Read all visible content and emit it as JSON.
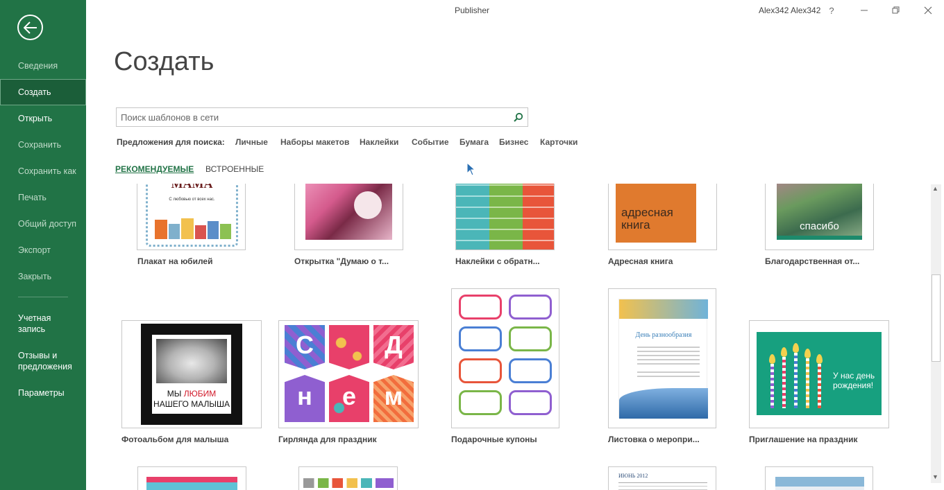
{
  "app": {
    "title": "Publisher",
    "user": "Alex342 Alex342"
  },
  "window_controls": {
    "help": "?",
    "minimize": "—",
    "restore": "❐",
    "close": "✕"
  },
  "sidebar": {
    "items": [
      {
        "label": "Сведения"
      },
      {
        "label": "Создать"
      },
      {
        "label": "Открыть"
      },
      {
        "label": "Сохранить"
      },
      {
        "label": "Сохранить как"
      },
      {
        "label": "Печать"
      },
      {
        "label": "Общий доступ"
      },
      {
        "label": "Экспорт"
      },
      {
        "label": "Закрыть"
      },
      {
        "label": "Учетная запись"
      },
      {
        "label": "Отзывы и предложения"
      },
      {
        "label": "Параметры"
      }
    ]
  },
  "main": {
    "title": "Создать",
    "search": {
      "placeholder": "Поиск шаблонов в сети",
      "value": ""
    },
    "suggestions_label": "Предложения для поиска:",
    "suggestions": [
      "Личные",
      "Наборы макетов",
      "Наклейки",
      "Событие",
      "Бумага",
      "Бизнес",
      "Карточки"
    ],
    "tabs": [
      {
        "label": "РЕКОМЕНДУЕМЫЕ"
      },
      {
        "label": "ВСТРОЕННЫЕ"
      }
    ],
    "templates": [
      {
        "label": "Плакат на юбилей",
        "text1": "МАМА",
        "text2": "С любовью от всех нас."
      },
      {
        "label": "Открытка \"Думаю о т..."
      },
      {
        "label": "Наклейки с обратн..."
      },
      {
        "label": "Адресная книга",
        "text1": "адресная книга"
      },
      {
        "label": "Благодарственная от...",
        "text1": "спасибо"
      },
      {
        "label": "Фотоальбом для малыша",
        "text1": "МЫ",
        "text2": "ЛЮБИМ",
        "text3": "НАШЕГО МАЛЫША"
      },
      {
        "label": "Гирлянда для праздник",
        "letters": [
          "С",
          "Д",
          "н",
          "е",
          "м"
        ]
      },
      {
        "label": "Подарочные купоны"
      },
      {
        "label": "Листовка о меропри...",
        "text1": "День разнообразия"
      },
      {
        "label": "Приглашение на праздник",
        "text1": "У нас день рождения!"
      }
    ],
    "partial_calendar": {
      "month": "ИЮНЬ 2012"
    }
  },
  "colors": {
    "accent": "#217346"
  }
}
